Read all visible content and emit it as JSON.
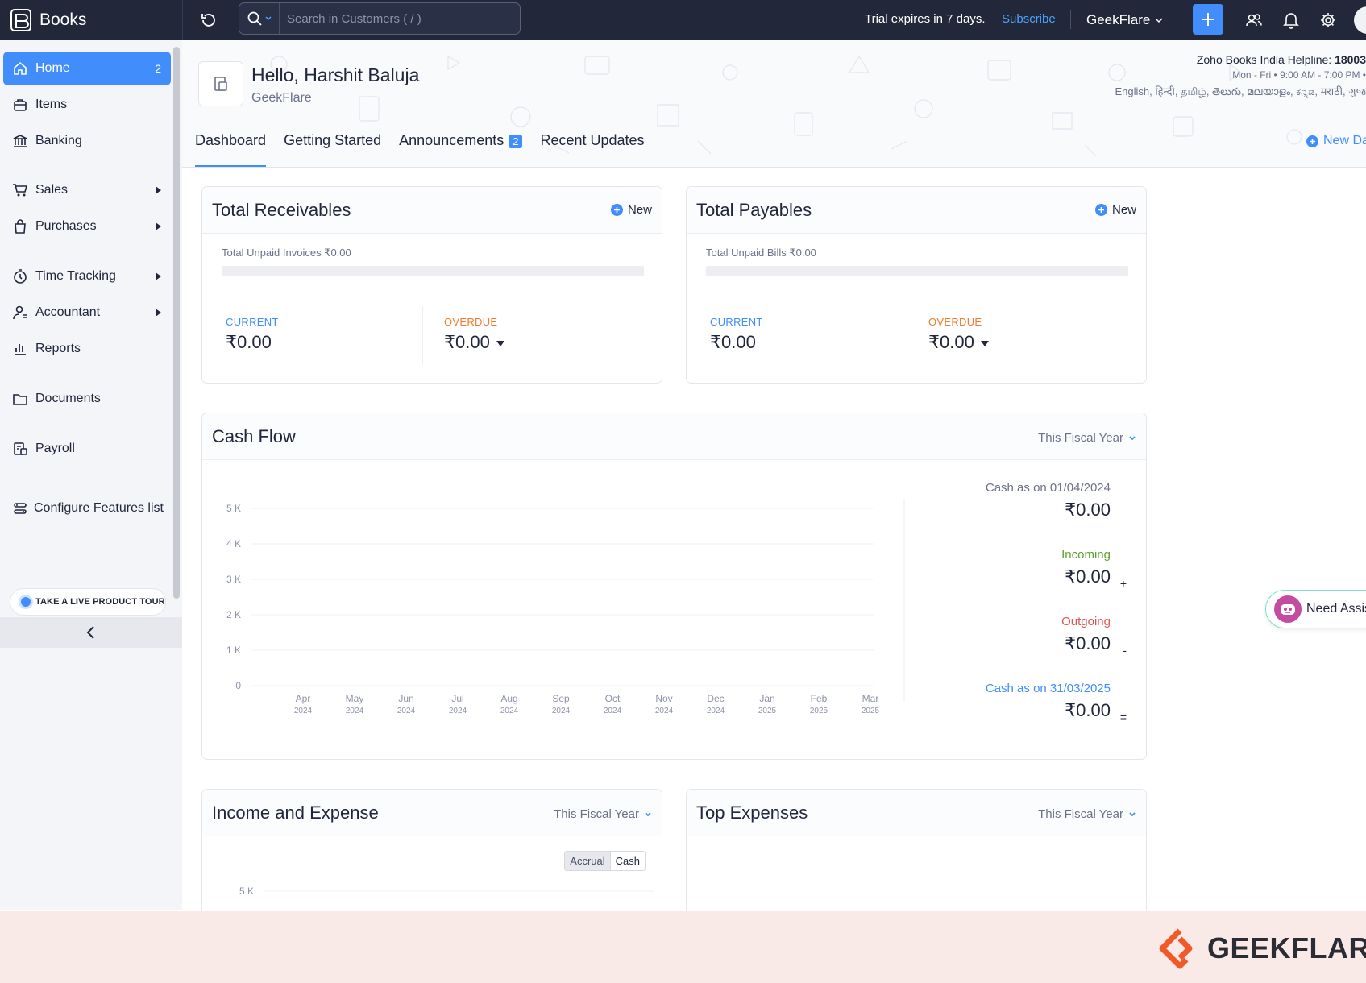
{
  "topbar": {
    "app_name": "Books",
    "search_placeholder": "Search in Customers ( / )",
    "trial_text": "Trial expires in 7 days.",
    "subscribe_label": "Subscribe",
    "org_name": "GeekFlare"
  },
  "sidebar": {
    "items": [
      {
        "label": "Home",
        "icon": "home-icon",
        "badge": "2"
      },
      {
        "label": "Items",
        "icon": "items-icon"
      },
      {
        "label": "Banking",
        "icon": "bank-icon"
      },
      {
        "label": "Sales",
        "icon": "cart-icon"
      },
      {
        "label": "Purchases",
        "icon": "bag-icon"
      },
      {
        "label": "Time Tracking",
        "icon": "timer-icon"
      },
      {
        "label": "Accountant",
        "icon": "accountant-icon"
      },
      {
        "label": "Reports",
        "icon": "reports-icon"
      },
      {
        "label": "Documents",
        "icon": "folder-icon"
      },
      {
        "label": "Payroll",
        "icon": "payroll-icon"
      },
      {
        "label": "Configure Features list",
        "icon": "configure-icon"
      }
    ],
    "tour_label": "TAKE A LIVE PRODUCT TOUR"
  },
  "header": {
    "greeting": "Hello, Harshit Baluja",
    "org": "GeekFlare",
    "helpline_label": "Zoho Books India Helpline: ",
    "helpline_number": "18003",
    "hours": "Mon - Fri • 9:00 AM - 7:00 PM •",
    "languages": "English, हिन्दी, தமிழ், తెలుగు, മലയാളം, ಕನ್ನಡ, मराठी, ગુજ",
    "tabs": [
      {
        "label": "Dashboard"
      },
      {
        "label": "Getting Started"
      },
      {
        "label": "Announcements",
        "badge": "2"
      },
      {
        "label": "Recent Updates"
      }
    ],
    "new_dashboard": "New Da"
  },
  "receivables": {
    "title": "Total Receivables",
    "new_label": "New",
    "unpaid": "Total Unpaid Invoices ₹0.00",
    "current_label": "CURRENT",
    "current_amount": "₹0.00",
    "overdue_label": "OVERDUE",
    "overdue_amount": "₹0.00",
    "progress": 0
  },
  "payables": {
    "title": "Total Payables",
    "new_label": "New",
    "unpaid": "Total Unpaid Bills ₹0.00",
    "current_label": "CURRENT",
    "current_amount": "₹0.00",
    "overdue_label": "OVERDUE",
    "overdue_amount": "₹0.00",
    "progress": 0
  },
  "cashflow": {
    "title": "Cash Flow",
    "period": "This Fiscal Year",
    "opening_label": "Cash as on 01/04/2024",
    "opening_amount": "₹0.00",
    "incoming_label": "Incoming",
    "incoming_amount": "₹0.00",
    "incoming_sign": "+",
    "outgoing_label": "Outgoing",
    "outgoing_amount": "₹0.00",
    "outgoing_sign": "-",
    "closing_label": "Cash as on 31/03/2025",
    "closing_amount": "₹0.00",
    "closing_sign": "=",
    "colors": {
      "incoming": "#5aa12d",
      "outgoing": "#e05353",
      "link": "#408dfb"
    }
  },
  "chart_data": [
    {
      "type": "line",
      "categories": [
        "Apr",
        "May",
        "Jun",
        "Jul",
        "Aug",
        "Sep",
        "Oct",
        "Nov",
        "Dec",
        "Jan",
        "Feb",
        "Mar"
      ],
      "category_years": [
        "2024",
        "2024",
        "2024",
        "2024",
        "2024",
        "2024",
        "2024",
        "2024",
        "2024",
        "2025",
        "2025",
        "2025"
      ],
      "y_ticks": [
        "0",
        "1 K",
        "2 K",
        "3 K",
        "4 K",
        "5 K"
      ],
      "series": [],
      "ylim": [
        0,
        5000
      ],
      "grid": true
    },
    {
      "type": "bar",
      "y_ticks": [
        "5 K"
      ],
      "series": [],
      "ylim": [
        0,
        5000
      ],
      "grid": true
    }
  ],
  "income_expense": {
    "title": "Income and Expense",
    "period": "This Fiscal Year",
    "toggle_accrual": "Accrual",
    "toggle_cash": "Cash"
  },
  "top_expenses": {
    "title": "Top Expenses",
    "period": "This Fiscal Year"
  },
  "assistant": {
    "label": "Need Assis"
  },
  "watermark": {
    "brand": "GEEKFLARE",
    "brand_color": "#f05a28"
  }
}
